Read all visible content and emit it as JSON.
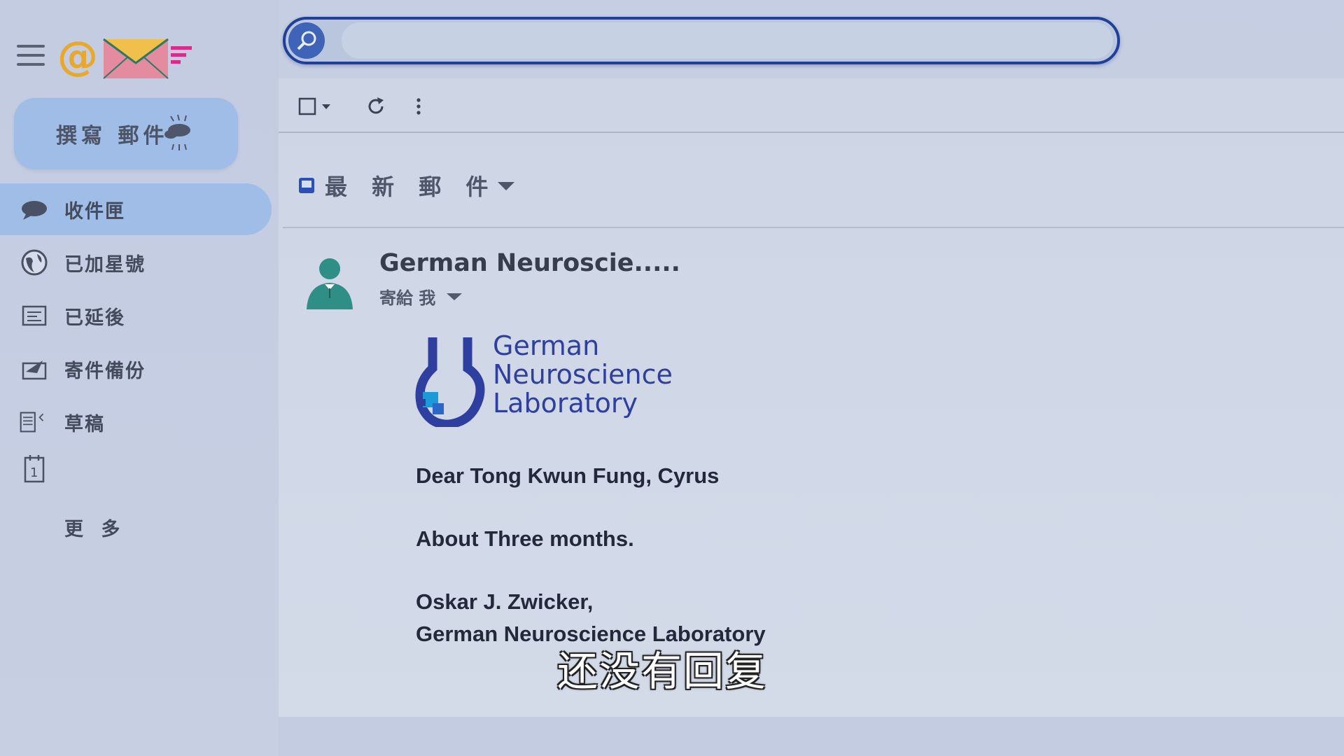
{
  "sidebar": {
    "compose_label": "撰寫 郵件",
    "items": [
      {
        "label": "收件匣",
        "icon": "chat-bubble-icon",
        "active": true
      },
      {
        "label": "已加星號",
        "icon": "globe-icon",
        "active": false
      },
      {
        "label": "已延後",
        "icon": "snooze-box-icon",
        "active": false
      },
      {
        "label": "寄件備份",
        "icon": "sent-icon",
        "active": false
      },
      {
        "label": "草稿",
        "icon": "draft-document-icon",
        "active": false
      },
      {
        "label": "",
        "icon": "calendar-day-icon",
        "active": false
      }
    ],
    "more_label": "更 多"
  },
  "search": {
    "placeholder": "",
    "value": ""
  },
  "toolbar": {
    "icons": [
      "select-checkbox-icon",
      "refresh-icon",
      "more-vert-icon"
    ]
  },
  "section": {
    "title": "最 新 郵 件"
  },
  "email": {
    "sender": "German Neuroscie.....",
    "to_me": "寄給 我",
    "org_logo_lines": [
      "German",
      "Neuroscience",
      "Laboratory"
    ],
    "greeting": "Dear Tong Kwun Fung, Cyrus",
    "body": "About Three months.",
    "signature_name": "Oskar J. Zwicker,",
    "signature_org": "German Neuroscience Laboratory"
  },
  "subtitle": "还没有回复",
  "colors": {
    "accent": "#9fbde6",
    "search_border": "#1f3f9a",
    "logo_blue": "#2e3fa0"
  }
}
